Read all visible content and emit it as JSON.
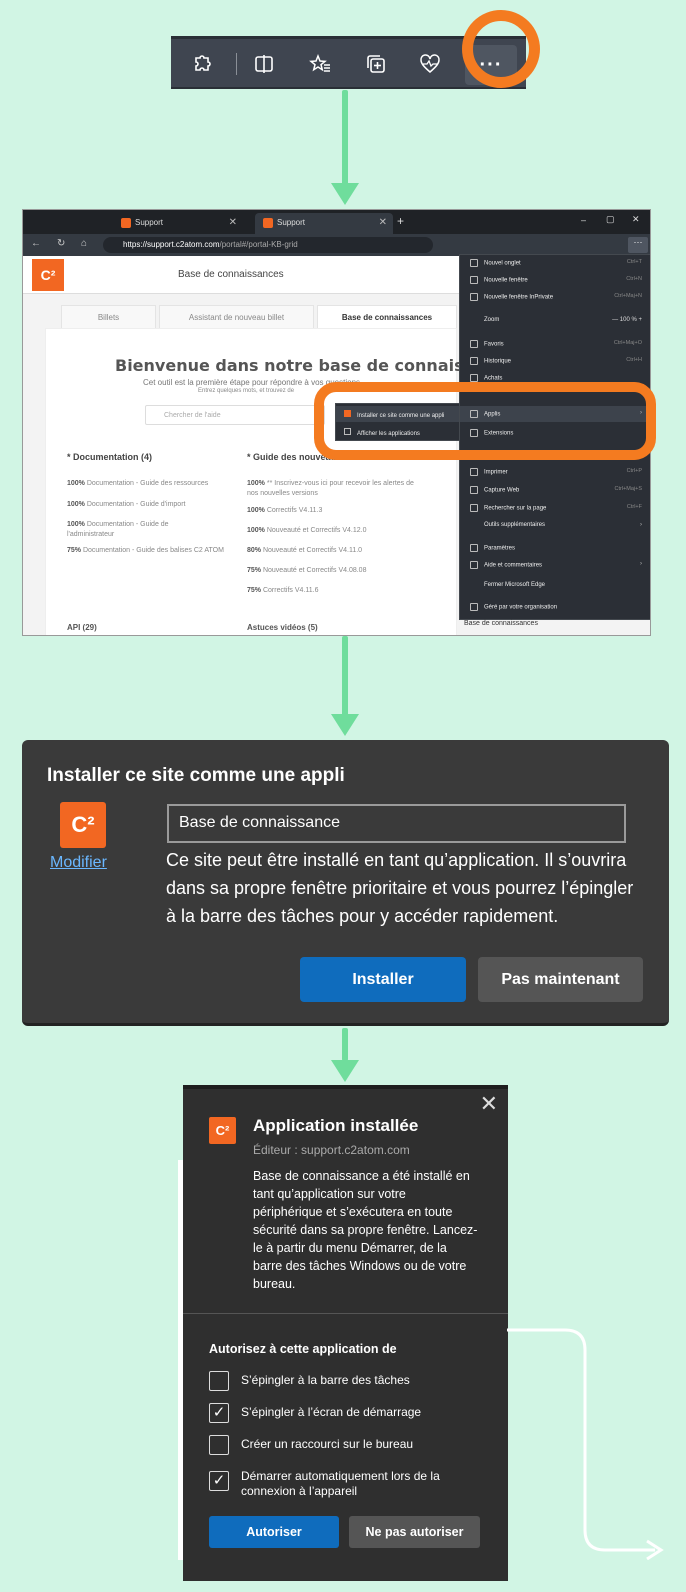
{
  "toolbar": {
    "icons": [
      "extensions-icon",
      "split-screen-icon",
      "favorites-icon",
      "collections-icon",
      "performance-icon"
    ],
    "more_label": "···"
  },
  "browser": {
    "tabs": [
      {
        "label": "Support"
      },
      {
        "label": "Support"
      }
    ],
    "new_tab": "+",
    "window_controls": [
      "–",
      "▢",
      "✕"
    ],
    "url_host": "https://support.c2atom.com",
    "url_path": "/portal#/portal-KB-grid",
    "site": {
      "logo": "C²",
      "header_title": "Base de connaissances",
      "tabs": [
        "Billets",
        "Assistant de nouveau billet",
        "Base de connaissances"
      ],
      "welcome": "Bienvenue dans notre base de connaissances",
      "welcome_sub": "Cet outil est la première étape pour répondre à vos questions.",
      "welcome_sub2": "Entrez quelques mots, et trouvez de",
      "search_placeholder": "Chercher de l'aide",
      "col1_title": "* Documentation (4)",
      "col1_items": [
        {
          "pct": "100%",
          "text": "Documentation - Guide des ressources"
        },
        {
          "pct": "100%",
          "text": "Documentation - Guide d'import"
        },
        {
          "pct": "100%",
          "text": "Documentation - Guide de l'administrateur"
        },
        {
          "pct": "75%",
          "text": "Documentation - Guide des balises C2 ATOM"
        }
      ],
      "col2_title": "* Guide des nouveau",
      "col2_items": [
        {
          "pct": "100%",
          "text": "** Inscrivez-vous ici pour recevoir les alertes de nos nouvelles versions"
        },
        {
          "pct": "100%",
          "text": "Correctifs V4.11.3"
        },
        {
          "pct": "100%",
          "text": "Nouveauté et Correctifs V4.12.0"
        },
        {
          "pct": "80%",
          "text": "Nouveauté et Correctifs V4.11.0"
        },
        {
          "pct": "75%",
          "text": "Nouveauté et Correctifs V4.08.08"
        },
        {
          "pct": "75%",
          "text": "Correctifs V4.11.6"
        }
      ],
      "api": "API (29)",
      "videos": "Astuces vidéos (5)"
    },
    "menu": [
      {
        "label": "Nouvel onglet",
        "shortcut": "Ctrl+T"
      },
      {
        "label": "Nouvelle fenêtre",
        "shortcut": "Ctrl+N"
      },
      {
        "label": "Nouvelle fenêtre InPrivate",
        "shortcut": "Ctrl+Maj+N"
      },
      {
        "label": "Zoom",
        "shortcut": "—   100 %   +"
      },
      {
        "label": "Favoris",
        "shortcut": "Ctrl+Maj+O"
      },
      {
        "label": "Historique",
        "shortcut": "Ctrl+H"
      },
      {
        "label": "Achats",
        "shortcut": ""
      },
      {
        "label": "Applis",
        "shortcut": "›"
      },
      {
        "label": "Extensions",
        "shortcut": ""
      },
      {
        "label": "Imprimer",
        "shortcut": "Ctrl+P"
      },
      {
        "label": "Capture Web",
        "shortcut": "Ctrl+Maj+S"
      },
      {
        "label": "Rechercher sur la page",
        "shortcut": "Ctrl+F"
      },
      {
        "label": "Outils supplémentaires",
        "shortcut": "›"
      },
      {
        "label": "Paramètres",
        "shortcut": ""
      },
      {
        "label": "Aide et commentaires",
        "shortcut": "›"
      },
      {
        "label": "Fermer Microsoft Edge",
        "shortcut": ""
      },
      {
        "label": "Géré par votre organisation",
        "shortcut": ""
      }
    ],
    "submenu": [
      "Installer ce site comme une appli",
      "Afficher les applications"
    ],
    "kb_link": "Base de connaissances"
  },
  "install": {
    "title": "Installer ce site comme une appli",
    "icon": "C²",
    "modify": "Modifier",
    "name_value": "Base de connaissance",
    "description": "Ce site peut être installé en tant qu’application. Il s’ouvrira dans sa propre fenêtre prioritaire et vous pourrez l’épingler à la barre des tâches pour y accéder rapidement.",
    "install_btn": "Installer",
    "later_btn": "Pas maintenant"
  },
  "installed": {
    "title": "Application installée",
    "publisher": "Éditeur : support.c2atom.com",
    "icon": "C²",
    "description": "Base de connaissance a été installé en tant qu’application sur votre périphérique et s’exécutera en toute sécurité dans sa propre fenêtre. Lancez-le à partir du menu Démarrer, de la barre des tâches Windows ou de votre bureau.",
    "allow_title": "Autorisez à cette application de",
    "permissions": [
      {
        "label": "S’épingler à la barre des tâches",
        "checked": false
      },
      {
        "label": "S’épingler à l’écran de démarrage",
        "checked": true
      },
      {
        "label": "Créer un raccourci sur le bureau",
        "checked": false
      },
      {
        "label": "Démarrer automatiquement lors de la connexion à l’appareil",
        "checked": true
      }
    ],
    "allow_btn": "Autoriser",
    "deny_btn": "Ne pas autoriser"
  },
  "colors": {
    "accent": "#f47b20",
    "arrow": "#6fdd9c",
    "primary": "#0f6cbd",
    "background": "#d1f5e4"
  }
}
